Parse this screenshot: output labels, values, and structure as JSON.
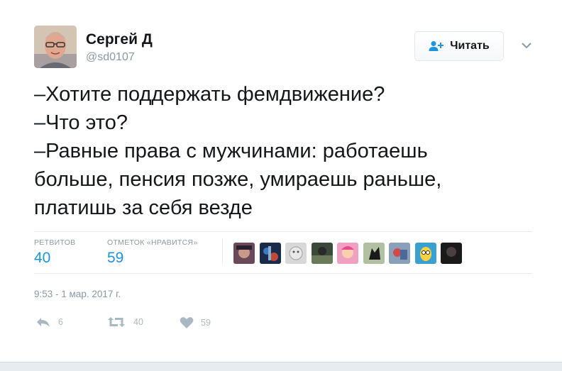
{
  "author": {
    "name": "Сергей Д",
    "handle": "@sd0107"
  },
  "follow_button": {
    "label": "Читать"
  },
  "tweet": {
    "lines": [
      "–Хотите поддержать фемдвижение?",
      "–Что это?",
      "–Равные права с мужчинами: работаешь",
      "больше, пенсия позже, умираешь раньше,",
      "платишь за себя везде"
    ]
  },
  "stats": {
    "retweets_label": "РЕТВИТОВ",
    "retweets_value": "40",
    "likes_label": "ОТМЕТОК «НРАВИТСЯ»",
    "likes_value": "59"
  },
  "timestamp": "9:53 - 1 мар. 2017 г.",
  "actions": {
    "reply_count": "6",
    "retweet_count": "40",
    "like_count": "59"
  },
  "colors": {
    "link_blue": "#1b95e0",
    "muted": "#8899a6",
    "icon_gray": "#aab8c2"
  },
  "icons": [
    "follow-person-plus-icon",
    "chevron-down-icon",
    "reply-icon",
    "retweet-icon",
    "heart-icon"
  ]
}
